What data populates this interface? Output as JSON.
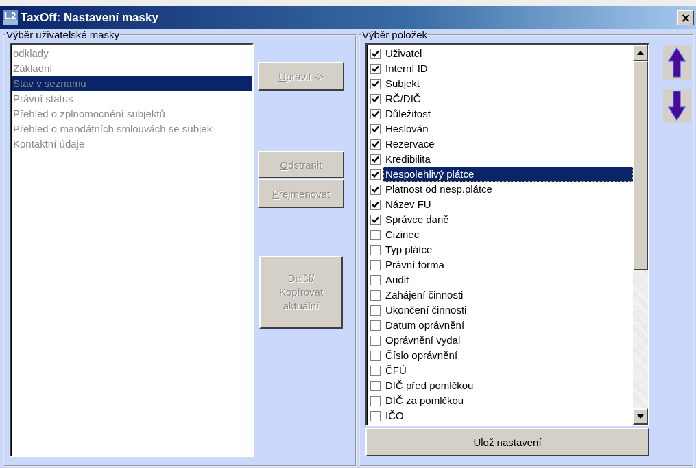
{
  "window": {
    "title": "TaxOff: Nastavení masky",
    "close": "×"
  },
  "mask_group": {
    "title": "Výběr uživatelské masky",
    "disabled": true,
    "items": [
      {
        "label": "odklady",
        "selected": false
      },
      {
        "label": "Základní",
        "selected": false
      },
      {
        "label": "Stav v seznamu",
        "selected": true
      },
      {
        "label": "Právní status",
        "selected": false
      },
      {
        "label": "Přehled o zplnomocnění subjektů",
        "selected": false
      },
      {
        "label": "Přehled o mandátních smlouvách se subjek",
        "selected": false
      },
      {
        "label": "Kontaktní údaje",
        "selected": false
      }
    ]
  },
  "actions": [
    {
      "label": "Upravit ->",
      "disabled": true,
      "underlined_key": true
    },
    {
      "label": "Odstranit",
      "disabled": true,
      "underlined_key": true
    },
    {
      "label": "Přejmenovat",
      "disabled": true,
      "underlined_key": true
    },
    {
      "label": "Další/ Kopírovat aktuální",
      "disabled": true,
      "underlined_key": false
    }
  ],
  "fields_group": {
    "title": "Výběr položek",
    "items": [
      {
        "label": "Uživatel",
        "checked": true,
        "selected": false
      },
      {
        "label": "Interní ID",
        "checked": true,
        "selected": false
      },
      {
        "label": "Subjekt",
        "checked": true,
        "selected": false
      },
      {
        "label": "RČ/DIČ",
        "checked": true,
        "selected": false
      },
      {
        "label": "Důležitost",
        "checked": true,
        "selected": false
      },
      {
        "label": "Heslován",
        "checked": true,
        "selected": false
      },
      {
        "label": "Rezervace",
        "checked": true,
        "selected": false
      },
      {
        "label": "Kredibilita",
        "checked": true,
        "selected": false
      },
      {
        "label": "Nespolehlivý plátce",
        "checked": true,
        "selected": true
      },
      {
        "label": "Platnost od nesp.plátce",
        "checked": true,
        "selected": false
      },
      {
        "label": "Název FU",
        "checked": true,
        "selected": false
      },
      {
        "label": "Správce daně",
        "checked": true,
        "selected": false
      },
      {
        "label": "Cizinec",
        "checked": false,
        "selected": false
      },
      {
        "label": "Typ plátce",
        "checked": false,
        "selected": false
      },
      {
        "label": "Právní forma",
        "checked": false,
        "selected": false
      },
      {
        "label": "Audit",
        "checked": false,
        "selected": false
      },
      {
        "label": "Zahájení činnosti",
        "checked": false,
        "selected": false
      },
      {
        "label": "Ukončení činnosti",
        "checked": false,
        "selected": false
      },
      {
        "label": "Datum oprávnění",
        "checked": false,
        "selected": false
      },
      {
        "label": "Oprávnění vydal",
        "checked": false,
        "selected": false
      },
      {
        "label": "Číslo oprávnění",
        "checked": false,
        "selected": false
      },
      {
        "label": "ČFÚ",
        "checked": false,
        "selected": false
      },
      {
        "label": "DIČ před pomlčkou",
        "checked": false,
        "selected": false
      },
      {
        "label": "DIČ za pomlčkou",
        "checked": false,
        "selected": false
      },
      {
        "label": "IČO",
        "checked": false,
        "selected": false
      }
    ],
    "save": {
      "label": "Ulož nastavení",
      "underlined_key": true
    }
  }
}
